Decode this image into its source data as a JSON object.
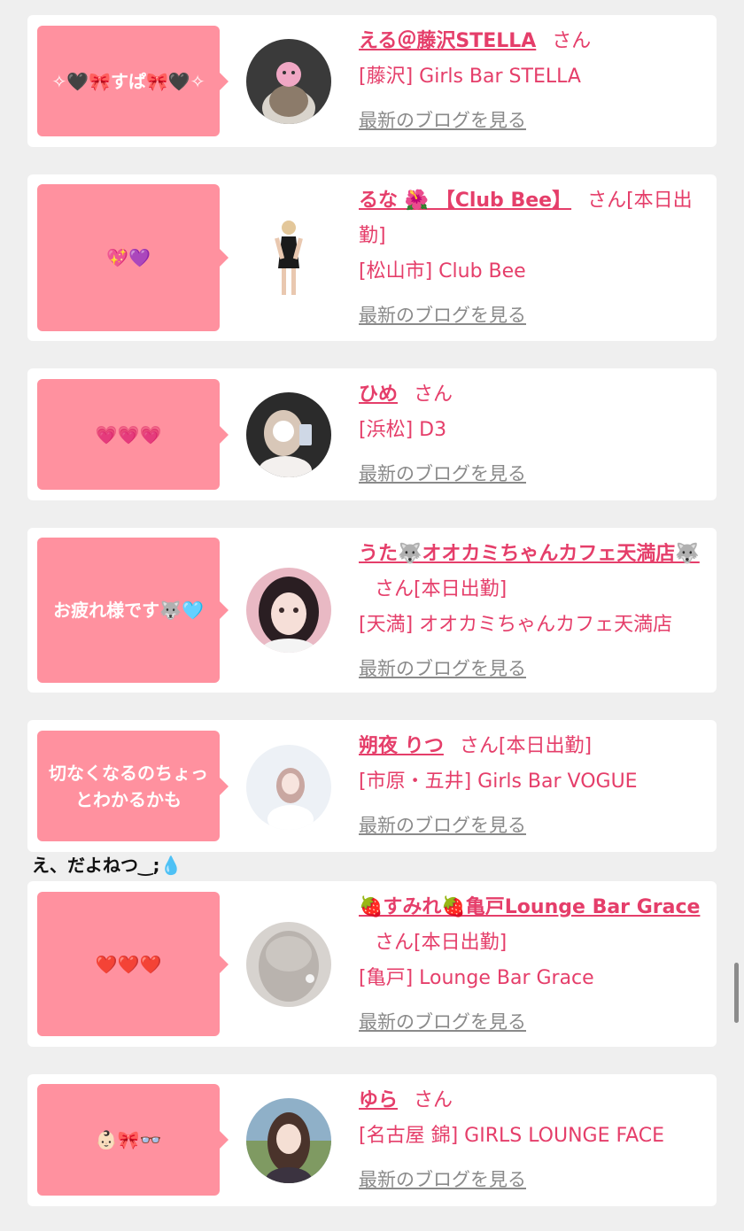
{
  "colors": {
    "accent": "#e53e6a",
    "bubble": "#ff919f",
    "background": "#efefef",
    "link_gray": "#8a8a8a"
  },
  "common": {
    "san": "さん",
    "blog_link": "最新のブログを見る"
  },
  "cards": [
    {
      "bubble": "✧🖤🎀すぱ🎀🖤✧",
      "name": "える＠藤沢STELLA",
      "status": "",
      "shop": "[藤沢] Girls Bar STELLA"
    },
    {
      "bubble": "💖💜",
      "name": "るな 🌺 【Club Bee】",
      "status": "[本日出勤]",
      "shop": "[松山市] Club Bee"
    },
    {
      "bubble": "💗💗💗",
      "name": "ひめ",
      "status": "",
      "shop": "[浜松] D3"
    },
    {
      "bubble": "お疲れ様です🐺🩵",
      "name": "うた🐺オオカミちゃんカフェ天満店🐺",
      "status": "[本日出勤]",
      "shop": "[天満] オオカミちゃんカフェ天満店"
    },
    {
      "bubble": "切なくなるのちょっとわかるかも",
      "name": "朔夜 りつ",
      "status": "[本日出勤]",
      "shop": "[市原・五井] Girls Bar VOGUE"
    },
    {
      "bubble": "❤️❤️❤️",
      "name": "🍓すみれ🍓亀戸Lounge Bar Grace",
      "status": "[本日出勤]",
      "shop": "[亀戸] Lounge Bar Grace"
    },
    {
      "bubble": "👶🏻🎀👓",
      "name": "ゆら",
      "status": "",
      "shop": "[名古屋 錦] GIRLS LOUNGE FACE"
    }
  ],
  "overflow_text": "え、だよねつ‿;💧"
}
